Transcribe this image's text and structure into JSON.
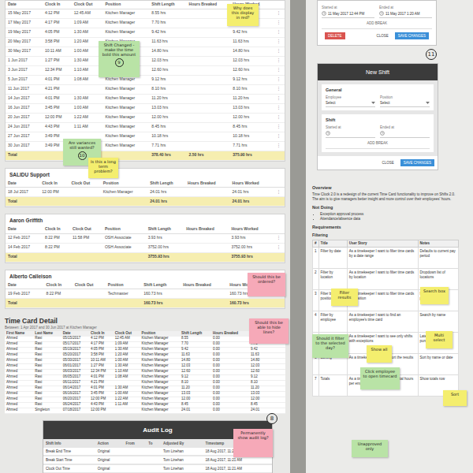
{
  "main_table": {
    "columns": [
      "Date",
      "Clock In",
      "Clock Out",
      "Position",
      "Shift Length",
      "Hours Breaked",
      "Hours Worked"
    ],
    "menu_icon": "⋮",
    "rows": [
      [
        "15 May 2017",
        "4:12 PM",
        "12:45 AM",
        "Kitchen Manager",
        "8.55 hrs",
        "",
        "8.55 hrs"
      ],
      [
        "17 May 2017",
        "4:17 PM",
        "1:09 AM",
        "Kitchen Manager",
        "7.70 hrs",
        "",
        "7.70 hrs"
      ],
      [
        "19 May 2017",
        "4:05 PM",
        "1:30 AM",
        "Kitchen Manager",
        "9.42 hrs",
        "",
        "9.42 hrs"
      ],
      [
        "20 May 2017",
        "3:58 PM",
        "1:20 AM",
        "Kitchen Manager",
        "11.63 hrs",
        "",
        "11.63 hrs"
      ],
      [
        "30 May 2017",
        "10:11 AM",
        "1:00 AM",
        "Kitchen Manager",
        "14.80 hrs",
        "",
        "14.80 hrs"
      ],
      [
        "1 Jun 2017",
        "1:27 PM",
        "1:30 AM",
        "Kitchen Manager",
        "12.03 hrs",
        "",
        "12.03 hrs"
      ],
      [
        "3 Jun 2017",
        "12:34 PM",
        "1:10 AM",
        "Kitchen Manager",
        "12.60 hrs",
        "",
        "12.60 hrs"
      ],
      [
        "5 Jun 2017",
        "4:01 PM",
        "1:08 AM",
        "Kitchen Manager",
        "9.12 hrs",
        "",
        "9.12 hrs"
      ],
      [
        "11 Jun 2017",
        "4:21 PM",
        "",
        "Kitchen Manager",
        "8.10 hrs",
        "",
        "8.10 hrs"
      ],
      [
        "14 Jun 2017",
        "4:01 PM",
        "1:30 AM",
        "Kitchen Manager",
        "11.20 hrs",
        "",
        "11.20 hrs"
      ],
      [
        "16 Jun 2017",
        "3:45 PM",
        "1:00 AM",
        "Kitchen Manager",
        "13.03 hrs",
        "",
        "13.03 hrs"
      ],
      [
        "20 Jun 2017",
        "12:00 PM",
        "1:22 AM",
        "Kitchen Manager",
        "12.00 hrs",
        "",
        "12.00 hrs"
      ],
      [
        "24 Jun 2017",
        "4:43 PM",
        "1:11 AM",
        "Kitchen Manager",
        "8.45 hrs",
        "",
        "8.45 hrs"
      ],
      [
        "27 Jun 2017",
        "3:49 PM",
        "",
        "Kitchen Manager",
        "10.18 hrs",
        "",
        "10.18 hrs"
      ],
      [
        "30 Jun 2017",
        "3:49 PM",
        "",
        "Kitchen Manager",
        "7.71 hrs",
        "",
        "7.71 hrs"
      ]
    ],
    "total": {
      "label": "Total",
      "values": [
        "378.40 hrs",
        "2.50 hrs",
        "375.90 hrs"
      ]
    }
  },
  "employees": [
    {
      "name": "SALIDU Support",
      "rows": [
        [
          "18 Jul 2017",
          "12:00 PM",
          "",
          "Kitchen Manager",
          "24.01 hrs",
          "",
          "24.01 hrs"
        ]
      ],
      "total": [
        "24.01 hrs",
        "",
        "24.01 hrs"
      ]
    },
    {
      "name": "Aaron Griffith",
      "rows": [
        [
          "12 Feb 2017",
          "8:22 PM",
          "11:58 PM",
          "OSH Associate",
          "3.93 hrs",
          "",
          "3.93 hrs"
        ],
        [
          "14 Feb 2017",
          "8:22 PM",
          "",
          "OSH Associate",
          "3752.00 hrs",
          "",
          "3752.00 hrs"
        ]
      ],
      "total": [
        "3755.93 hrs",
        "",
        "3755.93 hrs"
      ]
    },
    {
      "name": "Alberto Calleison",
      "rows": [
        [
          "19 Feb 2017",
          "8:22 PM",
          "",
          "Techmaster",
          "160.73 hrs",
          "",
          "160.73 hrs"
        ]
      ],
      "total": [
        "160.73 hrs",
        "",
        "160.73 hrs"
      ]
    }
  ],
  "time_card": {
    "title": "Time Card Detail",
    "subtitle": "Between: 1 Apr 2017 and 30 Jun 2017 at Kitchen Manager",
    "columns": [
      "First Name",
      "Last Name",
      "Date",
      "Clock In",
      "Clock Out",
      "Position",
      "Shift Length",
      "Hours Breaked",
      "Hours Worked"
    ],
    "rows": [
      [
        "Ahmed",
        "Rasi",
        "05/15/2017",
        "4:12 PM",
        "12:45 AM",
        "Kitchen Manager",
        "8.55",
        "0.00",
        "8.55"
      ],
      [
        "Ahmed",
        "Rasi",
        "05/17/2017",
        "4:17 PM",
        "1:09 AM",
        "Kitchen Manager",
        "7.70",
        "0.00",
        "7.70"
      ],
      [
        "Ahmed",
        "Rasi",
        "05/19/2017",
        "4:05 PM",
        "1:30 AM",
        "Kitchen Manager",
        "9.42",
        "0.00",
        "9.42"
      ],
      [
        "Ahmed",
        "Rasi",
        "05/20/2017",
        "3:58 PM",
        "1:20 AM",
        "Kitchen Manager",
        "11.63",
        "0.00",
        "11.63"
      ],
      [
        "Ahmed",
        "Rasi",
        "05/30/2017",
        "10:11 AM",
        "1:00 AM",
        "Kitchen Manager",
        "14.80",
        "0.00",
        "14.80"
      ],
      [
        "Ahmed",
        "Rasi",
        "06/01/2017",
        "1:27 PM",
        "1:30 AM",
        "Kitchen Manager",
        "12.03",
        "0.00",
        "12.03"
      ],
      [
        "Ahmed",
        "Rasi",
        "06/03/2017",
        "12:34 PM",
        "1:10 AM",
        "Kitchen Manager",
        "12.60",
        "0.00",
        "12.60"
      ],
      [
        "Ahmed",
        "Rasi",
        "06/05/2017",
        "4:01 PM",
        "1:08 AM",
        "Kitchen Manager",
        "9.12",
        "0.00",
        "9.12"
      ],
      [
        "Ahmed",
        "Rasi",
        "06/11/2017",
        "4:21 PM",
        "",
        "Kitchen Manager",
        "8.10",
        "0.00",
        "8.10"
      ],
      [
        "Ahmed",
        "Rasi",
        "06/14/2017",
        "4:01 PM",
        "1:30 AM",
        "Kitchen Manager",
        "11.20",
        "0.00",
        "11.20"
      ],
      [
        "Ahmed",
        "Rasi",
        "06/16/2017",
        "3:45 PM",
        "1:00 AM",
        "Kitchen Manager",
        "13.03",
        "0.00",
        "13.03"
      ],
      [
        "Ahmed",
        "Rasi",
        "06/20/2017",
        "12:00 PM",
        "1:22 AM",
        "Kitchen Manager",
        "12.00",
        "0.00",
        "12.00"
      ],
      [
        "Ahmed",
        "Rasi",
        "06/24/2017",
        "4:43 PM",
        "1:11 AM",
        "Kitchen Manager",
        "8.45",
        "0.00",
        "8.45"
      ],
      [
        "Ahmed",
        "Singleton",
        "07/18/2017",
        "12:00 PM",
        "",
        "Kitchen Manager",
        "24.01",
        "0.00",
        "24.01"
      ]
    ]
  },
  "audit_log": {
    "title": "Audit Log",
    "columns": [
      "Shift Info",
      "Action",
      "From",
      "To",
      "Adjusted By",
      "Timestamp"
    ],
    "rows": [
      [
        "Break End Time",
        "Original",
        "",
        "",
        "Tom Linehan",
        "18 Aug 2017, 11:21 AM"
      ],
      [
        "Break Start Time",
        "Original",
        "",
        "",
        "Tom Linehan",
        "18 Aug 2017, 11:21 AM"
      ],
      [
        "Clock Out Time",
        "Original",
        "",
        "",
        "Tom Linehan",
        "18 Aug 2017, 11:21 AM"
      ]
    ]
  },
  "edit_dialog": {
    "started_label": "Started at",
    "started_value": "11 May 2017 12:44 PM",
    "ended_label": "Ended at",
    "ended_value": "11 May 2017 1:20 AM",
    "add_break": "ADD BREAK",
    "delete": "DELETE",
    "close": "CLOSE",
    "save": "SAVE CHANGES"
  },
  "new_shift": {
    "title": "New Shift",
    "general": "General",
    "employee_label": "Employee",
    "employee_value": "Select",
    "position_label": "Position",
    "position_value": "Select",
    "shift": "Shift",
    "started_label": "Started at",
    "ended_label": "Ended at",
    "add_break": "ADD BREAK",
    "close": "CLOSE",
    "save": "SAVE CHANGES"
  },
  "requirements": {
    "overview_title": "Overview",
    "overview": "Time Clock 2.0 is a redesign of the current Time Card functionality to improve on Shifts 2.0. The aim is to give managers better insight and more control over their employees' hours.",
    "not_doing_title": "Not Doing",
    "not_doing": [
      "Exception approval process",
      "Attendance/absence data"
    ],
    "requirements_title": "Requirements",
    "filtering_title": "Filtering",
    "columns": [
      "#",
      "Title",
      "User Story",
      "Notes"
    ],
    "rows": [
      [
        "1",
        "Filter by date",
        "As a timekeeper I want to filter time cards by a date range",
        "Defaults to current pay period"
      ],
      [
        "2",
        "Filter by location",
        "As a timekeeper I want to filter time cards by location",
        "Dropdown list of locations"
      ],
      [
        "3",
        "Filter by position",
        "As a timekeeper I want to filter time cards by position",
        "Multi select list of positions"
      ],
      [
        "4",
        "Filter by employee",
        "As a timekeeper I want to find an employee's time card",
        "Search by name"
      ],
      [
        "5",
        "Filter by exception",
        "As a timekeeper I want to see only shifts with exceptions",
        "Late, early, missed punch"
      ],
      [
        "6",
        "Sorting",
        "As a timekeeper I want to sort the results",
        "Sort by name or date"
      ],
      [
        "7",
        "Totals",
        "As a timekeeper I want to see total hours per employee",
        "Show totals row"
      ]
    ]
  },
  "notes": [
    {
      "text": "Why does this display in red?",
      "marker": "",
      "color": "#f4ee6e"
    },
    {
      "text": "Shift Changed - make the time bold this amount",
      "marker": "9",
      "color": "#b9e3a6"
    },
    {
      "text": "Are variances still wanted?",
      "marker": "10",
      "color": "#b9e3a6"
    },
    {
      "text": "Is this a long term problem?",
      "marker": "",
      "color": "#f4ee6e"
    },
    {
      "text": "Should this be ordered?",
      "marker": "",
      "color": "#f6a9b8"
    },
    {
      "text": "Should this be able to hide lines?",
      "marker": "",
      "color": "#f6a9b8"
    },
    {
      "text": "Permanently show audit log?",
      "marker": "",
      "color": "#f6a9b8"
    },
    {
      "text": "Filter results",
      "marker": "",
      "color": "#f4ee6e"
    },
    {
      "text": "Search box",
      "marker": "",
      "color": "#f4ee6e"
    },
    {
      "text": "Should it filter to the selected day?",
      "marker": "",
      "color": "#b9e3a6"
    },
    {
      "text": "Show all",
      "marker": "",
      "color": "#f4ee6e"
    },
    {
      "text": "Click employee to open timecard",
      "marker": "",
      "color": "#b9e3a6"
    },
    {
      "text": "Multi select",
      "marker": "",
      "color": "#f4ee6e"
    },
    {
      "text": "Sort",
      "marker": "",
      "color": "#f4ee6e"
    },
    {
      "text": "Unapproved only",
      "marker": "",
      "color": "#b9e3a6"
    }
  ],
  "markers": {
    "audit_log": "8",
    "new_shift": "11"
  }
}
